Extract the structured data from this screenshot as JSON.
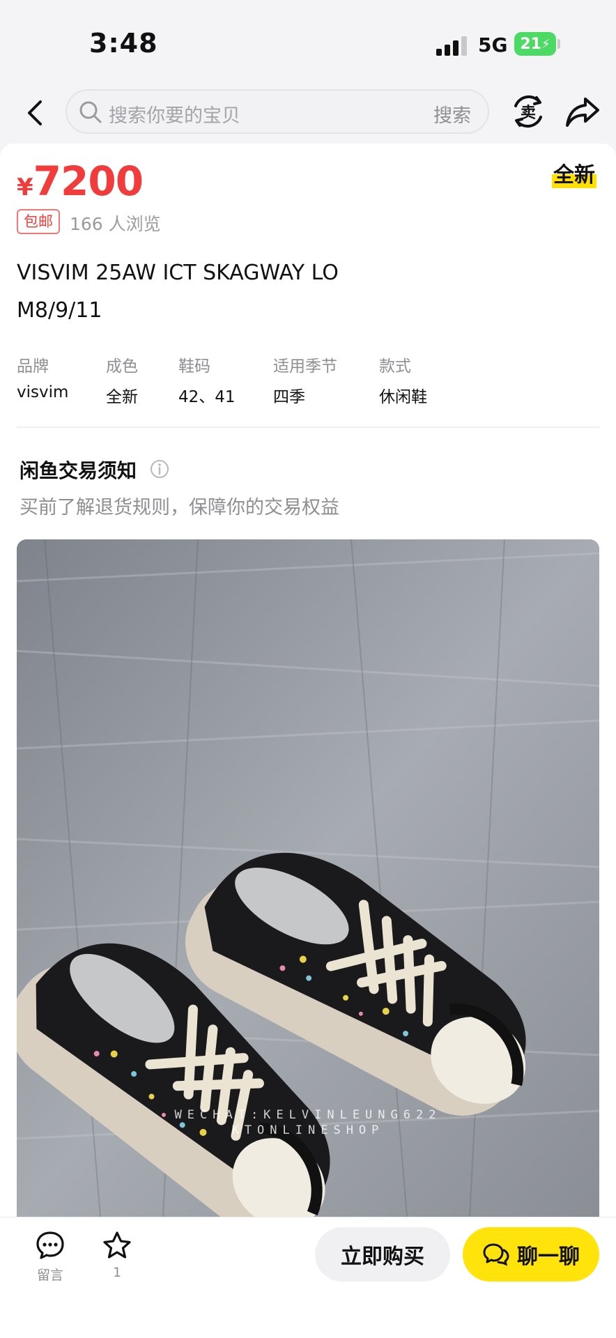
{
  "status_bar": {
    "time": "3:48",
    "network": "5G",
    "battery": "21"
  },
  "nav": {
    "search_placeholder": "搜索你要的宝贝",
    "search_button": "搜索",
    "sell_icon_glyph": "卖",
    "icons": [
      "back-icon",
      "search-icon",
      "sell-icon",
      "share-icon"
    ]
  },
  "product": {
    "currency": "¥",
    "price": "7200",
    "condition_tag": "全新",
    "shipping_badge": "包邮",
    "views": "166 人浏览",
    "title_line1": "VISVIM 25AW ICT SKAGWAY LO",
    "title_line2": "M8/9/11",
    "attributes": [
      {
        "key": "品牌",
        "value": "visvim"
      },
      {
        "key": "成色",
        "value": "全新"
      },
      {
        "key": "鞋码",
        "value": "42、41"
      },
      {
        "key": "适用季节",
        "value": "四季"
      },
      {
        "key": "款式",
        "value": "休闲鞋"
      }
    ]
  },
  "notice": {
    "title": "闲鱼交易须知",
    "subtitle": "买前了解退货规则，保障你的交易权益"
  },
  "photo": {
    "watermark_line1": "WECHAT:KELVINLEUNG622",
    "watermark_line2": "KTONLINESHOP"
  },
  "bottom_bar": {
    "comment_label": "留言",
    "favorite_count": "1",
    "buy_label": "立即购买",
    "chat_label": "聊一聊"
  },
  "colors": {
    "price_red": "#f23c3c",
    "accent_yellow": "#ffe30a",
    "battery_green": "#4cd964"
  }
}
